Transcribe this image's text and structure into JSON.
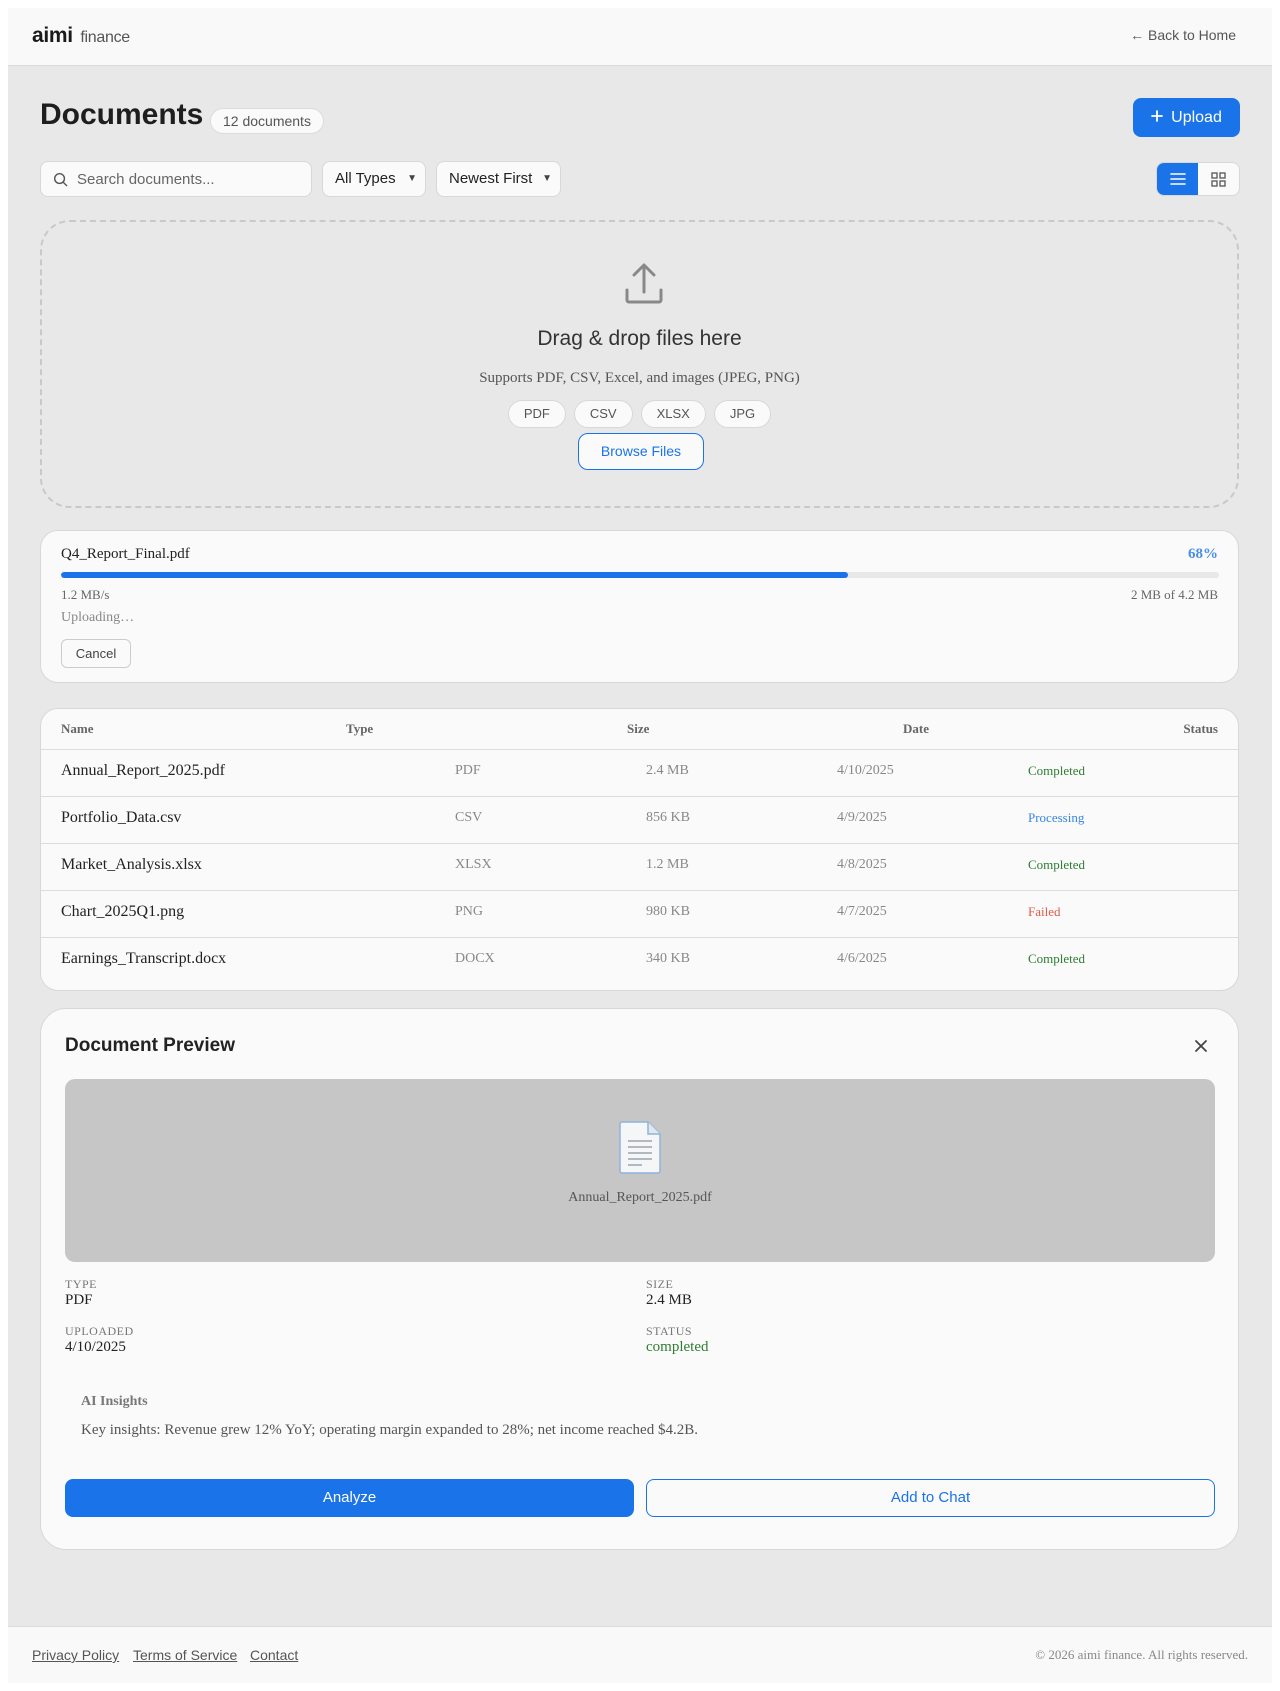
{
  "header": {
    "brand": "aimi",
    "brand_sub": "finance",
    "back_link": "← Back to Home"
  },
  "page": {
    "title": "Documents",
    "count_badge": "12 documents",
    "upload_label": "Upload"
  },
  "filters": {
    "search_placeholder": "Search documents...",
    "type_filter": "All Types",
    "sort_filter": "Newest First"
  },
  "dropzone": {
    "title": "Drag & drop files here",
    "subtitle": "Supports PDF, CSV, Excel, and images (JPEG, PNG)",
    "chips": [
      "PDF",
      "CSV",
      "XLSX",
      "JPG"
    ],
    "browse_label": "Browse Files"
  },
  "upload_progress": {
    "filename": "Q4_Report_Final.pdf",
    "percent_label": "68%",
    "percent": 68,
    "speed": "1.2 MB/s",
    "size": "2 MB of 4.2 MB",
    "status": "Uploading…",
    "cancel_label": "Cancel"
  },
  "table": {
    "headers": [
      "Name",
      "Type",
      "Size",
      "Date",
      "Status"
    ],
    "rows": [
      {
        "name": "Annual_Report_2025.pdf",
        "type": "PDF",
        "size": "2.4 MB",
        "date": "4/10/2025",
        "status": "Completed"
      },
      {
        "name": "Portfolio_Data.csv",
        "type": "CSV",
        "size": "856 KB",
        "date": "4/9/2025",
        "status": "Processing"
      },
      {
        "name": "Market_Analysis.xlsx",
        "type": "XLSX",
        "size": "1.2 MB",
        "date": "4/8/2025",
        "status": "Completed"
      },
      {
        "name": "Chart_2025Q1.png",
        "type": "PNG",
        "size": "980 KB",
        "date": "4/7/2025",
        "status": "Failed"
      },
      {
        "name": "Earnings_Transcript.docx",
        "type": "DOCX",
        "size": "340 KB",
        "date": "4/6/2025",
        "status": "Completed"
      }
    ]
  },
  "preview": {
    "title": "Document Preview",
    "filename": "Annual_Report_2025.pdf",
    "type_label": "TYPE",
    "type_value": "PDF",
    "size_label": "SIZE",
    "size_value": "2.4 MB",
    "uploaded_label": "UPLOADED",
    "uploaded_value": "4/10/2025",
    "status_label": "STATUS",
    "status_value": "completed",
    "ai_label": "AI Insights",
    "ai_text": "Key insights: Revenue grew 12% YoY; operating margin expanded to 28%; net income reached $4.2B.",
    "analyze_label": "Analyze",
    "chat_label": "Add to Chat"
  },
  "footer": {
    "links": [
      "Privacy Policy",
      "Terms of Service",
      "Contact"
    ],
    "copyright": "© 2026 aimi finance. All rights reserved."
  },
  "colors": {
    "accent": "#1a73e8",
    "completed": "#2e7d32",
    "processing": "#3a86e0",
    "failed": "#e05a4a"
  },
  "icons": [
    "search-icon",
    "plus-icon",
    "list-view-icon",
    "grid-view-icon",
    "upload-icon",
    "document-icon",
    "close-icon"
  ]
}
